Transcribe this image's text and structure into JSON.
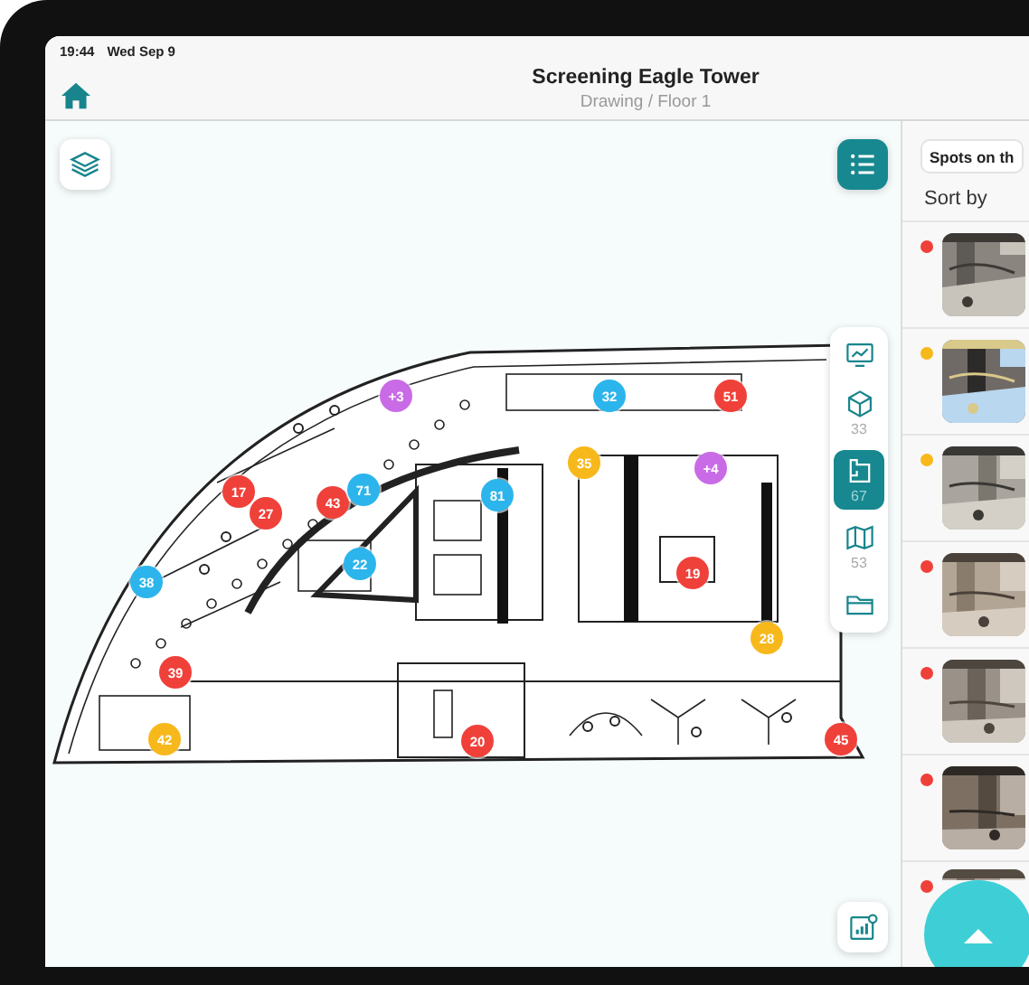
{
  "status_bar": {
    "time": "19:44",
    "date": "Wed Sep 9"
  },
  "header": {
    "title": "Screening Eagle Tower",
    "subtitle": "Drawing / Floor 1"
  },
  "map": {
    "pins": [
      {
        "label": "+3",
        "color": "#c96be6"
      },
      {
        "label": "32",
        "color": "#2bb5ec"
      },
      {
        "label": "51",
        "color": "#f0403a"
      },
      {
        "label": "17",
        "color": "#f0403a"
      },
      {
        "label": "27",
        "color": "#f0403a"
      },
      {
        "label": "43",
        "color": "#f0403a"
      },
      {
        "label": "71",
        "color": "#2bb5ec"
      },
      {
        "label": "81",
        "color": "#2bb5ec"
      },
      {
        "label": "35",
        "color": "#f7b81c"
      },
      {
        "label": "+4",
        "color": "#c96be6"
      },
      {
        "label": "38",
        "color": "#2bb5ec"
      },
      {
        "label": "22",
        "color": "#2bb5ec"
      },
      {
        "label": "19",
        "color": "#f0403a"
      },
      {
        "label": "28",
        "color": "#f7b81c"
      },
      {
        "label": "39",
        "color": "#f0403a"
      },
      {
        "label": "42",
        "color": "#f7b81c"
      },
      {
        "label": "20",
        "color": "#f0403a"
      },
      {
        "label": "45",
        "color": "#f0403a"
      }
    ]
  },
  "view_switcher": [
    {
      "kind": "chart",
      "selected": false
    },
    {
      "kind": "cube",
      "count": "33",
      "selected": false
    },
    {
      "kind": "plan",
      "count": "67",
      "selected": true
    },
    {
      "kind": "map",
      "count": "53",
      "selected": false
    },
    {
      "kind": "folder",
      "selected": false
    }
  ],
  "spots_panel": {
    "filter": "Spots on th",
    "sort_label": "Sort by"
  }
}
